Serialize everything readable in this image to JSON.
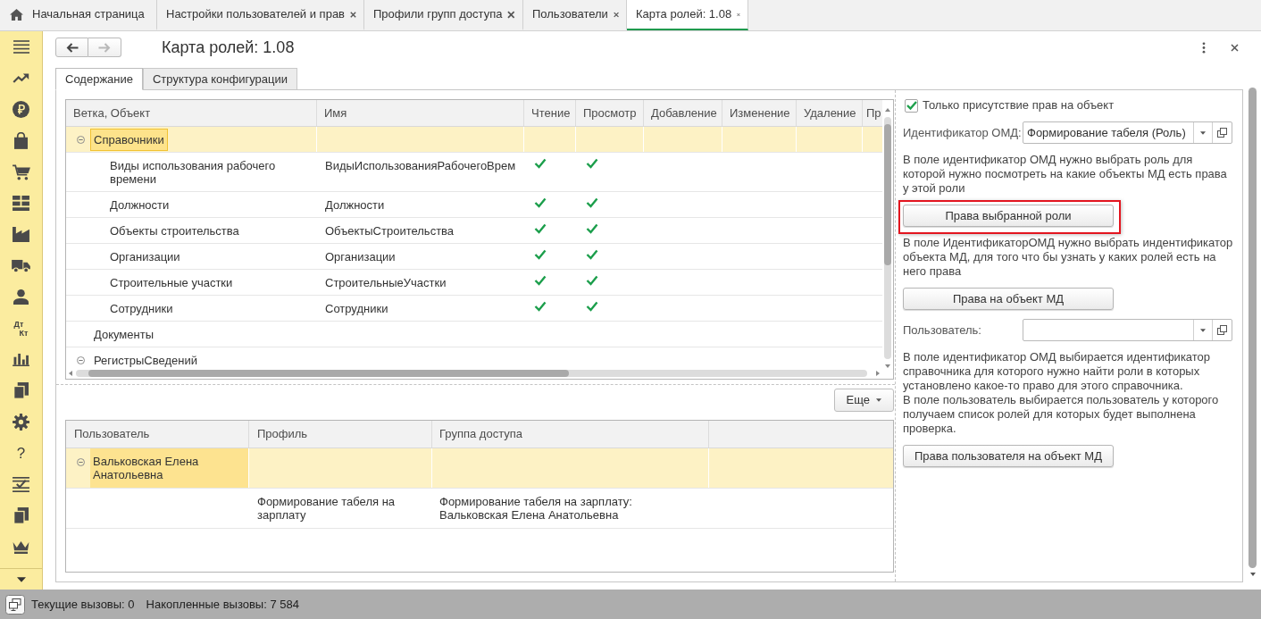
{
  "tabs": [
    {
      "kind": "home",
      "label": "Начальная страница",
      "selected": false,
      "closable": false
    },
    {
      "kind": "page",
      "label": "Настройки пользователей и прав",
      "selected": false,
      "closable": true
    },
    {
      "kind": "page",
      "label": "Профили групп доступа",
      "selected": false,
      "closable": true
    },
    {
      "kind": "page",
      "label": "Пользователи",
      "selected": false,
      "closable": true
    },
    {
      "kind": "page",
      "label": "Карта ролей: 1.08",
      "selected": true,
      "closable": true
    }
  ],
  "sidebar": {
    "items": [
      {
        "kind": "icon"
      },
      {
        "kind": "icon"
      },
      {
        "kind": "icon"
      },
      {
        "kind": "icon"
      },
      {
        "kind": "icon"
      },
      {
        "kind": "icon"
      },
      {
        "kind": "icon"
      },
      {
        "kind": "icon"
      },
      {
        "kind": "icon"
      },
      {
        "kind": "text",
        "lines": [
          "Дт",
          "Кт"
        ]
      },
      {
        "kind": "icon"
      },
      {
        "kind": "icon"
      },
      {
        "kind": "icon"
      },
      {
        "kind": "text",
        "lines": [
          "?"
        ]
      },
      {
        "kind": "icon"
      },
      {
        "kind": "icon"
      },
      {
        "kind": "icon"
      }
    ]
  },
  "nav_buttons": [
    {
      "kind": "back",
      "disabled": false
    },
    {
      "kind": "forward",
      "disabled": true
    }
  ],
  "title": "Карта ролей: 1.08",
  "form_tabs": [
    {
      "label": "Содержание",
      "selected": true
    },
    {
      "label": "Структура конфигурации",
      "selected": false
    }
  ],
  "objects_table": {
    "columns": [
      "Ветка, Объект",
      "Имя",
      "Чтение",
      "Просмотр",
      "Добавление",
      "Изменение",
      "Удаление",
      "Пр"
    ],
    "rows": [
      {
        "object": "Справочники",
        "selected": true,
        "expanded": true,
        "children": [
          {
            "object": "Виды использования рабочего времени",
            "name": "ВидыИспользованияРабочегоВрем",
            "selected": false,
            "rights": [
              true,
              true,
              false,
              false,
              false,
              false
            ]
          },
          {
            "object": "Должности",
            "name": "Должности",
            "selected": false,
            "rights": [
              true,
              true,
              false,
              false,
              false,
              false
            ]
          },
          {
            "object": "Объекты строительства",
            "name": "ОбъектыСтроительства",
            "selected": false,
            "rights": [
              true,
              true,
              false,
              false,
              false,
              false
            ]
          },
          {
            "object": "Организации",
            "name": "Организации",
            "selected": false,
            "rights": [
              true,
              true,
              false,
              false,
              false,
              false
            ]
          },
          {
            "object": "Строительные участки",
            "name": "СтроительныеУчастки",
            "selected": false,
            "rights": [
              true,
              true,
              false,
              false,
              false,
              false
            ]
          },
          {
            "object": "Сотрудники",
            "name": "Сотрудники",
            "selected": false,
            "rights": [
              true,
              true,
              false,
              false,
              false,
              false
            ]
          }
        ]
      },
      {
        "object": "Документы",
        "selected": false
      },
      {
        "object": "РегистрыСведений",
        "selected": false,
        "expanded": true
      }
    ]
  },
  "more_button": {
    "label": "Еще"
  },
  "users_table": {
    "columns": [
      "Пользователь",
      "Профиль",
      "Группа доступа"
    ],
    "rows": [
      {
        "user": "Вальковская Елена Анатольевна",
        "selected": true,
        "expanded": true,
        "children": [
          {
            "profile": "Формирование табеля на зарплату",
            "access_group": "Формирование табеля на зарплату: Вальковская Елена Анатольевна",
            "selected": false
          }
        ]
      }
    ]
  },
  "settings_panel": {
    "items": [
      {
        "kind": "checkbox",
        "label": "Только присутствие прав на объект",
        "checked": true
      },
      {
        "kind": "field",
        "label": "Идентификатор ОМД:",
        "value": "Формирование табеля (Роль)"
      },
      {
        "kind": "text",
        "paragraphs": [
          "В поле идентификатор ОМД нужно выбрать роль для которой нужно посмотреть на какие объекты МД есть права у этой роли"
        ]
      },
      {
        "kind": "button",
        "label": "Права выбранной роли",
        "highlighted": true
      },
      {
        "kind": "text",
        "paragraphs": [
          "В поле ИдентификаторОМД нужно выбрать индентификатор объекта МД, для того что бы узнать у каких ролей есть на него права"
        ]
      },
      {
        "kind": "button",
        "label": "Права на объект МД",
        "highlighted": false
      },
      {
        "kind": "field",
        "label": "Пользователь:"
      },
      {
        "kind": "text",
        "paragraphs": [
          "В поле идентификатор ОМД выбирается идентификатор справочника для которого нужно найти роли в которых установлено какое-то право для этого справочника.",
          "В поле пользователь выбирается пользователь у которого получаем список ролей для которых будет выполнена проверка."
        ]
      },
      {
        "kind": "button",
        "label": "Права пользователя на объект МД",
        "highlighted": false
      }
    ]
  },
  "status_bar": {
    "items": [
      "Текущие вызовы: 0",
      "Накопленные вызовы: 7 584"
    ]
  }
}
